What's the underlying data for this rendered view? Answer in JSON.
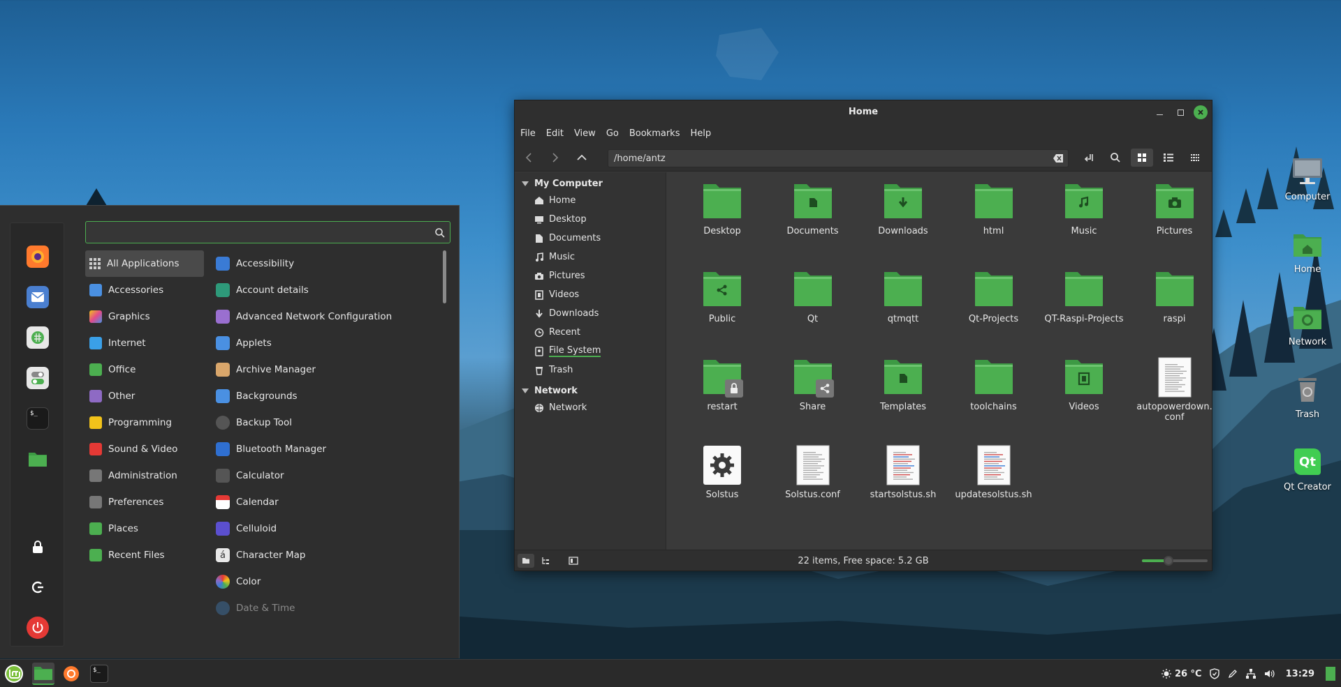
{
  "desktop": {
    "icons": [
      {
        "label": "Computer",
        "icon": "computer-icon"
      },
      {
        "label": "Home",
        "icon": "home-folder-icon"
      },
      {
        "label": "Network",
        "icon": "network-icon"
      },
      {
        "label": "Trash",
        "icon": "trash-icon"
      },
      {
        "label": "Qt Creator",
        "icon": "qt-creator-icon",
        "glyph": "Qt"
      }
    ]
  },
  "menu": {
    "search": {
      "value": "",
      "placeholder": ""
    },
    "favorites": [
      {
        "icon": "firefox-icon",
        "color": "#ff7a2d"
      },
      {
        "icon": "mail-icon",
        "color": "#4a7fd0"
      },
      {
        "icon": "spreadsheet-icon",
        "color": "#4caf50"
      },
      {
        "icon": "settings-toggle-icon",
        "color": "#5a5a5a"
      },
      {
        "icon": "terminal-icon",
        "color": "#1e1e1e"
      },
      {
        "icon": "files-icon",
        "color": "#4caf50"
      },
      {
        "icon": "lock-icon",
        "color": "#2a2a2a"
      },
      {
        "icon": "logout-icon",
        "color": "#2a2a2a"
      },
      {
        "icon": "power-icon",
        "color": "#e53935"
      }
    ],
    "categories": [
      {
        "label": "All Applications",
        "icon": "grid-icon",
        "color": "#bbbbbb",
        "active": true
      },
      {
        "label": "Accessories",
        "icon": "accessories-icon",
        "color": "#4a90e2"
      },
      {
        "label": "Graphics",
        "icon": "graphics-icon",
        "color": "#e24a8b"
      },
      {
        "label": "Internet",
        "icon": "internet-icon",
        "color": "#3aa0e8"
      },
      {
        "label": "Office",
        "icon": "office-icon",
        "color": "#4caf50"
      },
      {
        "label": "Other",
        "icon": "other-icon",
        "color": "#8e6ac4"
      },
      {
        "label": "Programming",
        "icon": "programming-icon",
        "color": "#f2c31a"
      },
      {
        "label": "Sound & Video",
        "icon": "sound-video-icon",
        "color": "#e53935"
      },
      {
        "label": "Administration",
        "icon": "administration-icon",
        "color": "#777777"
      },
      {
        "label": "Preferences",
        "icon": "preferences-icon",
        "color": "#777777"
      },
      {
        "label": "Places",
        "icon": "places-icon",
        "color": "#4caf50"
      },
      {
        "label": "Recent Files",
        "icon": "recent-files-icon",
        "color": "#4caf50"
      }
    ],
    "apps": [
      {
        "label": "Accessibility",
        "icon": "accessibility-icon",
        "color": "#3a7bd5"
      },
      {
        "label": "Account details",
        "icon": "account-icon",
        "color": "#2e9a7a"
      },
      {
        "label": "Advanced Network Configuration",
        "icon": "network-config-icon",
        "color": "#9a6fd0"
      },
      {
        "label": "Applets",
        "icon": "applets-icon",
        "color": "#4a90e2"
      },
      {
        "label": "Archive Manager",
        "icon": "archive-icon",
        "color": "#d9a66b"
      },
      {
        "label": "Backgrounds",
        "icon": "backgrounds-icon",
        "color": "#4a90e2"
      },
      {
        "label": "Backup Tool",
        "icon": "backup-icon",
        "color": "#555555"
      },
      {
        "label": "Bluetooth Manager",
        "icon": "bluetooth-icon",
        "color": "#2f6fd0"
      },
      {
        "label": "Calculator",
        "icon": "calculator-icon",
        "color": "#555555"
      },
      {
        "label": "Calendar",
        "icon": "calendar-icon",
        "color": "#e53935"
      },
      {
        "label": "Celluloid",
        "icon": "celluloid-icon",
        "color": "#5b4fcf"
      },
      {
        "label": "Character Map",
        "icon": "character-map-icon",
        "color": "#e8e8e8",
        "glyph": "á"
      },
      {
        "label": "Color",
        "icon": "color-icon",
        "color": "#e0a030"
      },
      {
        "label": "Date & Time",
        "icon": "date-time-icon",
        "color": "#3d6fa0",
        "dim": true
      }
    ]
  },
  "filemanager": {
    "title": "Home",
    "menubar": [
      "File",
      "Edit",
      "View",
      "Go",
      "Bookmarks",
      "Help"
    ],
    "path": "/home/antz",
    "sidebar": {
      "sections": [
        {
          "title": "My Computer",
          "items": [
            {
              "label": "Home",
              "icon": "home-icon"
            },
            {
              "label": "Desktop",
              "icon": "desktop-icon"
            },
            {
              "label": "Documents",
              "icon": "document-icon"
            },
            {
              "label": "Music",
              "icon": "music-icon"
            },
            {
              "label": "Pictures",
              "icon": "camera-icon"
            },
            {
              "label": "Videos",
              "icon": "film-icon"
            },
            {
              "label": "Downloads",
              "icon": "download-icon"
            },
            {
              "label": "Recent",
              "icon": "clock-icon"
            },
            {
              "label": "File System",
              "icon": "drive-icon",
              "selected": true
            },
            {
              "label": "Trash",
              "icon": "trash-icon"
            }
          ]
        },
        {
          "title": "Network",
          "items": [
            {
              "label": "Network",
              "icon": "network-icon"
            }
          ]
        }
      ]
    },
    "items": [
      {
        "label": "Desktop",
        "type": "folder",
        "emblem": ""
      },
      {
        "label": "Documents",
        "type": "folder",
        "emblem": "document"
      },
      {
        "label": "Downloads",
        "type": "folder",
        "emblem": "download"
      },
      {
        "label": "html",
        "type": "folder",
        "emblem": ""
      },
      {
        "label": "Music",
        "type": "folder",
        "emblem": "music"
      },
      {
        "label": "Pictures",
        "type": "folder",
        "emblem": "camera"
      },
      {
        "label": "Public",
        "type": "folder",
        "emblem": "share"
      },
      {
        "label": "Qt",
        "type": "folder",
        "emblem": ""
      },
      {
        "label": "qtmqtt",
        "type": "folder",
        "emblem": ""
      },
      {
        "label": "Qt-Projects",
        "type": "folder",
        "emblem": ""
      },
      {
        "label": "QT-Raspi-Projects",
        "type": "folder",
        "emblem": ""
      },
      {
        "label": "raspi",
        "type": "folder",
        "emblem": ""
      },
      {
        "label": "restart",
        "type": "folder",
        "emblem": "lock"
      },
      {
        "label": "Share",
        "type": "folder",
        "emblem": "shared"
      },
      {
        "label": "Templates",
        "type": "folder",
        "emblem": "document"
      },
      {
        "label": "toolchains",
        "type": "folder",
        "emblem": ""
      },
      {
        "label": "Videos",
        "type": "folder",
        "emblem": "film"
      },
      {
        "label": "autopowerdown.\nconf",
        "type": "text",
        "emblem": ""
      },
      {
        "label": "Solstus",
        "type": "executable",
        "emblem": ""
      },
      {
        "label": "Solstus.conf",
        "type": "text",
        "emblem": ""
      },
      {
        "label": "startsolstus.sh",
        "type": "script",
        "emblem": ""
      },
      {
        "label": "updatesolstus.sh",
        "type": "script",
        "emblem": ""
      }
    ],
    "status": "22 items, Free space: 5.2 GB",
    "zoom_level": 0.4,
    "accent": "#4caf50"
  },
  "panel": {
    "launchers": [
      {
        "icon": "mint-menu-icon"
      },
      {
        "icon": "files-icon",
        "active": true
      },
      {
        "icon": "firefox-icon"
      },
      {
        "icon": "terminal-icon"
      }
    ],
    "weather": "26 °C",
    "clock": "13:29"
  }
}
